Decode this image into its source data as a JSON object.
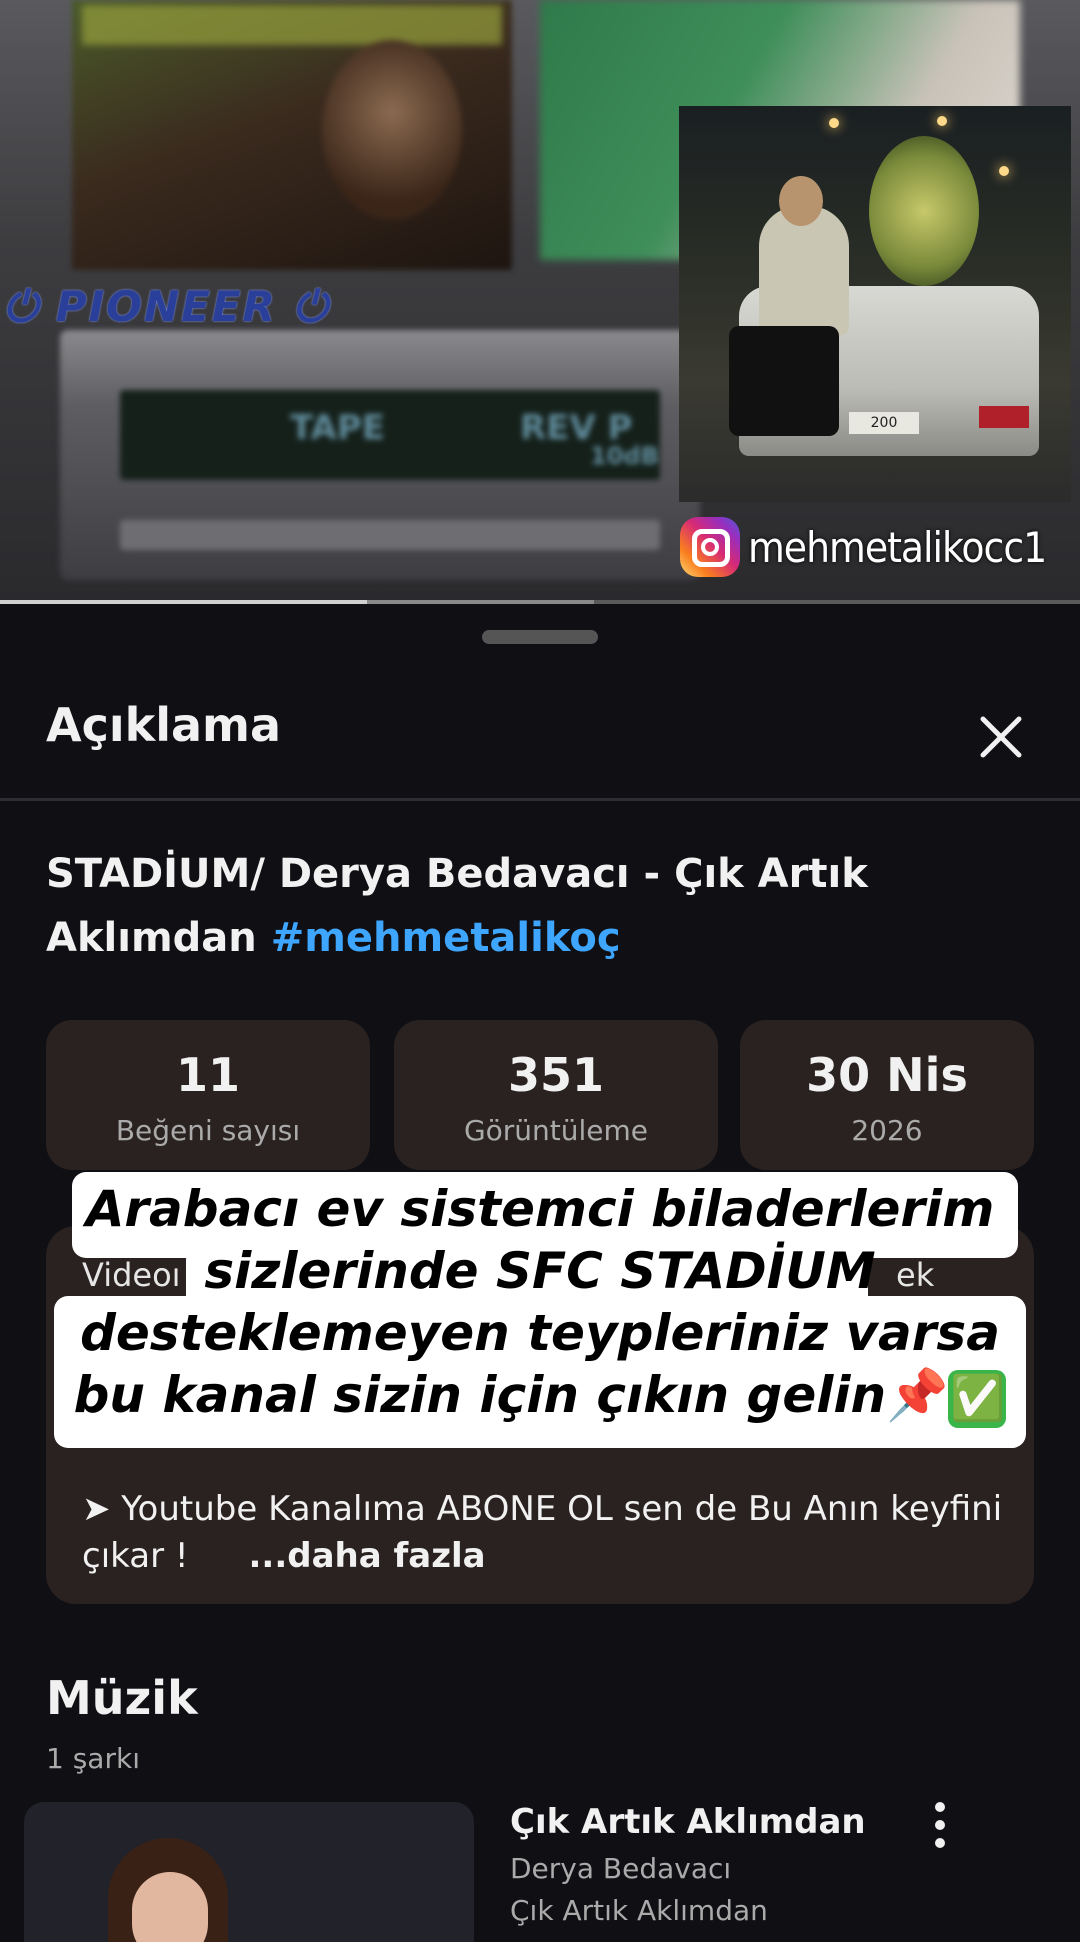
{
  "video": {
    "brand_text": "PIONEER",
    "stereo_display": [
      "TAPE",
      "REV P",
      "10dB"
    ],
    "instagram_handle": "mehmetalikocc1",
    "plate_text": "200",
    "progress_percent": 34,
    "buffered_percent": 55
  },
  "sheet": {
    "title": "Açıklama",
    "close_icon": "close-icon"
  },
  "video_info": {
    "title": "STADİUM/ Derya Bedavacı - Çık Artık Aklımdan",
    "hashtag": "#mehmetalikoç"
  },
  "stats": [
    {
      "value": "11",
      "label": "Beğeni sayısı"
    },
    {
      "value": "351",
      "label": "Görüntüleme"
    },
    {
      "value": "30 Nis",
      "label": "2026"
    }
  ],
  "description": {
    "visible_start": "Videoı",
    "visible_end": "ek",
    "line": "➤ Youtube Kanalıma ABONE OL sen de Bu Anın keyfini çıkar !",
    "more": "...daha fazla"
  },
  "overlay": {
    "line1": "Arabacı ev sistemci biladerlerim",
    "line2": "sizlerinde SFC STADİUM",
    "line3": "desteklemeyen teypleriniz varsa",
    "line4": "bu kanal sizin için çıkın gelin",
    "emoji_pin": "📌",
    "emoji_check": "✅"
  },
  "music": {
    "title": "Müzik",
    "count": "1 şarkı",
    "song": {
      "title": "Çık Artık Aklımdan",
      "artist": "Derya Bedavacı",
      "album": "Çık Artık Aklımdan"
    }
  }
}
